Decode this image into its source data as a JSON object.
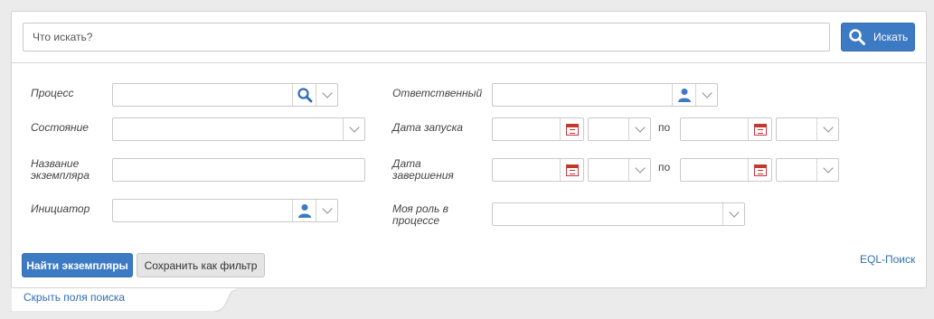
{
  "search": {
    "placeholder": "Что искать?",
    "button_label": "Искать"
  },
  "fields": {
    "process_label": "Процесс",
    "state_label": "Состояние",
    "instance_name_label_line1": "Название",
    "instance_name_label_line2": "экземпляра",
    "initiator_label": "Инициатор",
    "responsible_label": "Ответственный",
    "start_date_label": "Дата запуска",
    "end_date_label_line1": "Дата",
    "end_date_label_line2": "завершения",
    "role_label_line1": "Моя роль в",
    "role_label_line2": "процессе",
    "range_separator": "по"
  },
  "actions": {
    "find_label": "Найти экземпляры",
    "save_filter_label": "Сохранить как фильтр",
    "eql_label": "EQL-Поиск",
    "hide_fields_label": "Скрыть поля поиска"
  },
  "icons": {
    "search": "search-icon",
    "person": "person-icon",
    "calendar": "calendar-icon",
    "chevron": "chevron-down-icon"
  },
  "colors": {
    "accent": "#3d7ac4",
    "link": "#2f6db5",
    "calendar": "#c0392b"
  }
}
